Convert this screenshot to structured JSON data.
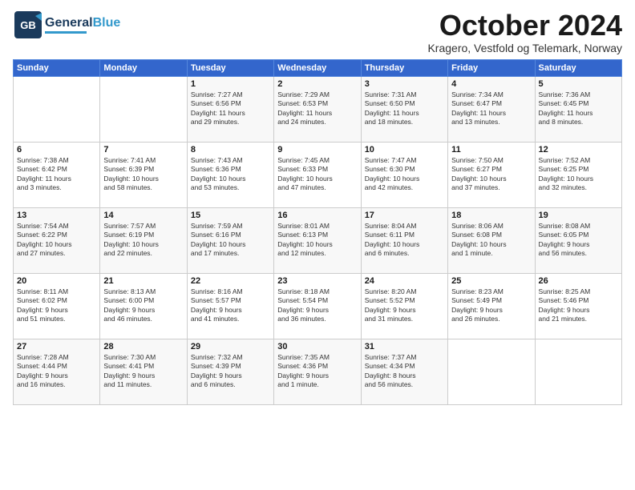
{
  "logo": {
    "part1": "General",
    "part2": "Blue"
  },
  "title": "October 2024",
  "subtitle": "Kragero, Vestfold og Telemark, Norway",
  "days_of_week": [
    "Sunday",
    "Monday",
    "Tuesday",
    "Wednesday",
    "Thursday",
    "Friday",
    "Saturday"
  ],
  "weeks": [
    [
      {
        "day": "",
        "info": ""
      },
      {
        "day": "",
        "info": ""
      },
      {
        "day": "1",
        "info": "Sunrise: 7:27 AM\nSunset: 6:56 PM\nDaylight: 11 hours\nand 29 minutes."
      },
      {
        "day": "2",
        "info": "Sunrise: 7:29 AM\nSunset: 6:53 PM\nDaylight: 11 hours\nand 24 minutes."
      },
      {
        "day": "3",
        "info": "Sunrise: 7:31 AM\nSunset: 6:50 PM\nDaylight: 11 hours\nand 18 minutes."
      },
      {
        "day": "4",
        "info": "Sunrise: 7:34 AM\nSunset: 6:47 PM\nDaylight: 11 hours\nand 13 minutes."
      },
      {
        "day": "5",
        "info": "Sunrise: 7:36 AM\nSunset: 6:45 PM\nDaylight: 11 hours\nand 8 minutes."
      }
    ],
    [
      {
        "day": "6",
        "info": "Sunrise: 7:38 AM\nSunset: 6:42 PM\nDaylight: 11 hours\nand 3 minutes."
      },
      {
        "day": "7",
        "info": "Sunrise: 7:41 AM\nSunset: 6:39 PM\nDaylight: 10 hours\nand 58 minutes."
      },
      {
        "day": "8",
        "info": "Sunrise: 7:43 AM\nSunset: 6:36 PM\nDaylight: 10 hours\nand 53 minutes."
      },
      {
        "day": "9",
        "info": "Sunrise: 7:45 AM\nSunset: 6:33 PM\nDaylight: 10 hours\nand 47 minutes."
      },
      {
        "day": "10",
        "info": "Sunrise: 7:47 AM\nSunset: 6:30 PM\nDaylight: 10 hours\nand 42 minutes."
      },
      {
        "day": "11",
        "info": "Sunrise: 7:50 AM\nSunset: 6:27 PM\nDaylight: 10 hours\nand 37 minutes."
      },
      {
        "day": "12",
        "info": "Sunrise: 7:52 AM\nSunset: 6:25 PM\nDaylight: 10 hours\nand 32 minutes."
      }
    ],
    [
      {
        "day": "13",
        "info": "Sunrise: 7:54 AM\nSunset: 6:22 PM\nDaylight: 10 hours\nand 27 minutes."
      },
      {
        "day": "14",
        "info": "Sunrise: 7:57 AM\nSunset: 6:19 PM\nDaylight: 10 hours\nand 22 minutes."
      },
      {
        "day": "15",
        "info": "Sunrise: 7:59 AM\nSunset: 6:16 PM\nDaylight: 10 hours\nand 17 minutes."
      },
      {
        "day": "16",
        "info": "Sunrise: 8:01 AM\nSunset: 6:13 PM\nDaylight: 10 hours\nand 12 minutes."
      },
      {
        "day": "17",
        "info": "Sunrise: 8:04 AM\nSunset: 6:11 PM\nDaylight: 10 hours\nand 6 minutes."
      },
      {
        "day": "18",
        "info": "Sunrise: 8:06 AM\nSunset: 6:08 PM\nDaylight: 10 hours\nand 1 minute."
      },
      {
        "day": "19",
        "info": "Sunrise: 8:08 AM\nSunset: 6:05 PM\nDaylight: 9 hours\nand 56 minutes."
      }
    ],
    [
      {
        "day": "20",
        "info": "Sunrise: 8:11 AM\nSunset: 6:02 PM\nDaylight: 9 hours\nand 51 minutes."
      },
      {
        "day": "21",
        "info": "Sunrise: 8:13 AM\nSunset: 6:00 PM\nDaylight: 9 hours\nand 46 minutes."
      },
      {
        "day": "22",
        "info": "Sunrise: 8:16 AM\nSunset: 5:57 PM\nDaylight: 9 hours\nand 41 minutes."
      },
      {
        "day": "23",
        "info": "Sunrise: 8:18 AM\nSunset: 5:54 PM\nDaylight: 9 hours\nand 36 minutes."
      },
      {
        "day": "24",
        "info": "Sunrise: 8:20 AM\nSunset: 5:52 PM\nDaylight: 9 hours\nand 31 minutes."
      },
      {
        "day": "25",
        "info": "Sunrise: 8:23 AM\nSunset: 5:49 PM\nDaylight: 9 hours\nand 26 minutes."
      },
      {
        "day": "26",
        "info": "Sunrise: 8:25 AM\nSunset: 5:46 PM\nDaylight: 9 hours\nand 21 minutes."
      }
    ],
    [
      {
        "day": "27",
        "info": "Sunrise: 7:28 AM\nSunset: 4:44 PM\nDaylight: 9 hours\nand 16 minutes."
      },
      {
        "day": "28",
        "info": "Sunrise: 7:30 AM\nSunset: 4:41 PM\nDaylight: 9 hours\nand 11 minutes."
      },
      {
        "day": "29",
        "info": "Sunrise: 7:32 AM\nSunset: 4:39 PM\nDaylight: 9 hours\nand 6 minutes."
      },
      {
        "day": "30",
        "info": "Sunrise: 7:35 AM\nSunset: 4:36 PM\nDaylight: 9 hours\nand 1 minute."
      },
      {
        "day": "31",
        "info": "Sunrise: 7:37 AM\nSunset: 4:34 PM\nDaylight: 8 hours\nand 56 minutes."
      },
      {
        "day": "",
        "info": ""
      },
      {
        "day": "",
        "info": ""
      }
    ]
  ]
}
